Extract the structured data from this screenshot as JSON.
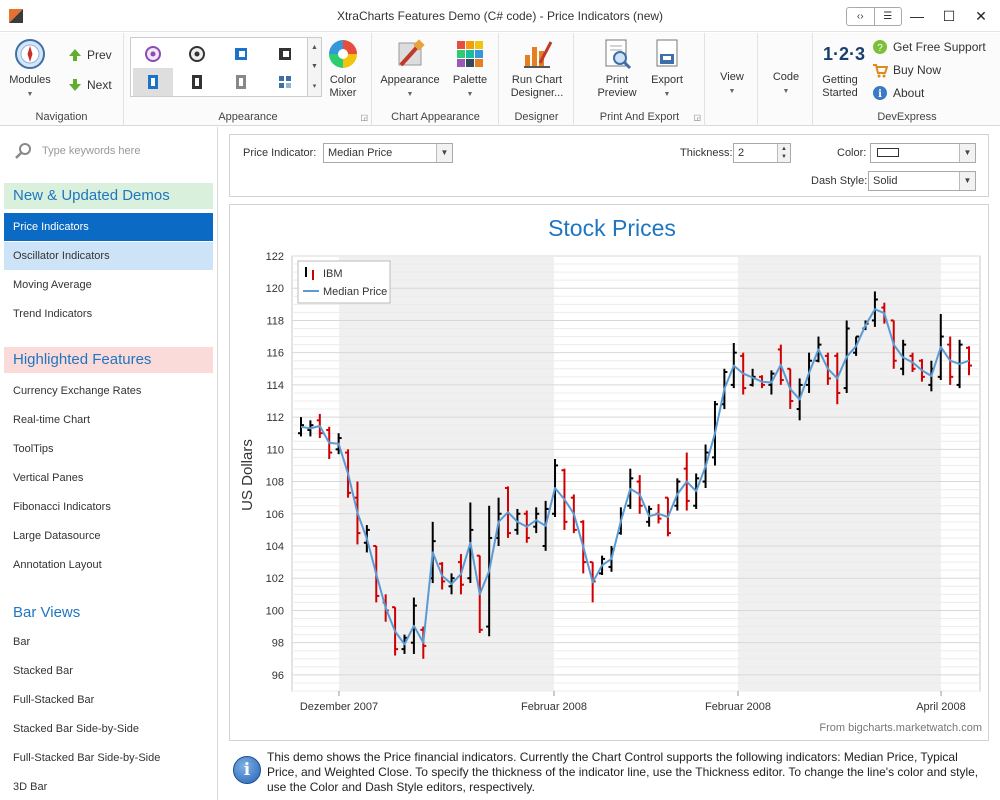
{
  "window": {
    "title": "XtraCharts Features Demo (C# code) - Price Indicators (new)",
    "controls": {
      "minimize": "—",
      "maximize": "☐",
      "close": "✕"
    }
  },
  "ribbon": {
    "navigation": {
      "label": "Navigation",
      "modules": "Modules",
      "prev": "Prev",
      "next": "Next"
    },
    "appearance": {
      "label": "Appearance",
      "color_mixer_1": "Color",
      "color_mixer_2": "Mixer"
    },
    "chart_appearance": {
      "label": "Chart Appearance",
      "appearance": "Appearance",
      "palette": "Palette"
    },
    "designer": {
      "label": "Designer",
      "run_1": "Run Chart",
      "run_2": "Designer..."
    },
    "print_export": {
      "label": "Print And Export",
      "print_1": "Print",
      "print_2": "Preview",
      "export": "Export"
    },
    "view": {
      "label": "View"
    },
    "code": {
      "label": "Code"
    },
    "devexpress": {
      "label": "DevExpress",
      "getting_1": "Getting",
      "getting_2": "Started",
      "getting_icon_text": "1·2·3",
      "support": "Get Free Support",
      "buy": "Buy Now",
      "about": "About"
    }
  },
  "sidebar": {
    "search_placeholder": "Type keywords here",
    "section1": "New & Updated Demos",
    "items1": [
      "Price Indicators",
      "Oscillator Indicators",
      "Moving Average",
      "Trend Indicators"
    ],
    "section2": "Highlighted Features",
    "items2": [
      "Currency Exchange Rates",
      "Real-time Chart",
      "ToolTips",
      "Vertical Panes",
      "Fibonacci Indicators",
      "Large Datasource",
      "Annotation Layout"
    ],
    "section3": "Bar Views",
    "items3": [
      "Bar",
      "Stacked Bar",
      "Full-Stacked Bar",
      "Stacked Bar Side-by-Side",
      "Full-Stacked Bar Side-by-Side",
      "3D Bar"
    ]
  },
  "options": {
    "indicator_label": "Price Indicator:",
    "indicator_value": "Median Price",
    "thickness_label": "Thickness:",
    "thickness_value": "2",
    "color_label": "Color:",
    "dash_label": "Dash Style:",
    "dash_value": "Solid"
  },
  "colors": {
    "accent": "#0b6ac4",
    "rising": "#000000",
    "falling": "#d00000",
    "indicator": "#5a9bd5",
    "title": "#1f76c0"
  },
  "chart_data": {
    "type": "stock",
    "title": "Stock Prices",
    "ylabel": "US Dollars",
    "ylim": [
      95,
      122
    ],
    "yticks": [
      96,
      98,
      100,
      102,
      104,
      106,
      108,
      110,
      112,
      114,
      116,
      118,
      120,
      122
    ],
    "xticks": [
      "Dezember 2007",
      "Februar 2008",
      "Februar 2008",
      "April 2008"
    ],
    "source": "From bigcharts.marketwatch.com",
    "legend": {
      "position": "top-left",
      "stock": "IBM",
      "indicator": "Median Price"
    },
    "series": [
      {
        "name": "IBM",
        "bars": [
          {
            "h": 112.0,
            "l": 110.8,
            "o": 111.0,
            "c": 111.5
          },
          {
            "h": 111.8,
            "l": 110.8,
            "o": 111.2,
            "c": 111.5
          },
          {
            "h": 112.2,
            "l": 110.7,
            "o": 111.8,
            "c": 111.0
          },
          {
            "h": 111.4,
            "l": 109.4,
            "o": 111.2,
            "c": 109.8
          },
          {
            "h": 111.0,
            "l": 109.7,
            "o": 110.0,
            "c": 110.7
          },
          {
            "h": 110.0,
            "l": 107.0,
            "o": 109.8,
            "c": 107.3
          },
          {
            "h": 108.0,
            "l": 104.1,
            "o": 107.0,
            "c": 104.8
          },
          {
            "h": 105.3,
            "l": 103.6,
            "o": 104.2,
            "c": 105.0
          },
          {
            "h": 104.0,
            "l": 100.5,
            "o": 104.0,
            "c": 100.9
          },
          {
            "h": 101.0,
            "l": 99.3,
            "o": 100.5,
            "c": 100.0
          },
          {
            "h": 100.2,
            "l": 97.2,
            "o": 100.2,
            "c": 97.6
          },
          {
            "h": 98.5,
            "l": 97.3,
            "o": 97.6,
            "c": 98.3
          },
          {
            "h": 100.8,
            "l": 97.3,
            "o": 98.0,
            "c": 100.3
          },
          {
            "h": 99.0,
            "l": 97.0,
            "o": 98.8,
            "c": 97.8
          },
          {
            "h": 105.5,
            "l": 101.7,
            "o": 102.0,
            "c": 104.3
          },
          {
            "h": 103.0,
            "l": 101.3,
            "o": 102.9,
            "c": 101.8
          },
          {
            "h": 102.3,
            "l": 101.0,
            "o": 101.5,
            "c": 102.0
          },
          {
            "h": 103.5,
            "l": 101.0,
            "o": 103.0,
            "c": 101.6
          },
          {
            "h": 106.7,
            "l": 101.7,
            "o": 102.0,
            "c": 105.0
          },
          {
            "h": 103.4,
            "l": 98.6,
            "o": 103.4,
            "c": 98.8
          },
          {
            "h": 106.5,
            "l": 98.4,
            "o": 99.0,
            "c": 104.5
          },
          {
            "h": 107.0,
            "l": 104.0,
            "o": 104.5,
            "c": 106.0
          },
          {
            "h": 107.7,
            "l": 104.5,
            "o": 107.6,
            "c": 104.8
          },
          {
            "h": 106.3,
            "l": 104.7,
            "o": 105.0,
            "c": 106.0
          },
          {
            "h": 106.2,
            "l": 104.2,
            "o": 106.0,
            "c": 104.5
          },
          {
            "h": 106.4,
            "l": 104.8,
            "o": 105.2,
            "c": 106.0
          },
          {
            "h": 106.8,
            "l": 103.7,
            "o": 104.0,
            "c": 106.3
          },
          {
            "h": 109.4,
            "l": 105.8,
            "o": 106.0,
            "c": 109.0
          },
          {
            "h": 108.8,
            "l": 105.0,
            "o": 108.7,
            "c": 105.5
          },
          {
            "h": 107.2,
            "l": 104.8,
            "o": 107.0,
            "c": 105.0
          },
          {
            "h": 105.6,
            "l": 102.3,
            "o": 105.5,
            "c": 103.0
          },
          {
            "h": 103.0,
            "l": 100.5,
            "o": 103.0,
            "c": 101.8
          },
          {
            "h": 103.4,
            "l": 102.2,
            "o": 102.3,
            "c": 103.2
          },
          {
            "h": 104.0,
            "l": 102.4,
            "o": 102.7,
            "c": 103.8
          },
          {
            "h": 106.4,
            "l": 104.7,
            "o": 104.8,
            "c": 106.0
          },
          {
            "h": 108.8,
            "l": 106.3,
            "o": 106.5,
            "c": 108.2
          },
          {
            "h": 108.4,
            "l": 106.0,
            "o": 108.0,
            "c": 106.5
          },
          {
            "h": 106.5,
            "l": 105.2,
            "o": 105.5,
            "c": 106.3
          },
          {
            "h": 106.6,
            "l": 105.4,
            "o": 106.0,
            "c": 105.7
          },
          {
            "h": 107.0,
            "l": 104.6,
            "o": 107.0,
            "c": 104.8
          },
          {
            "h": 108.2,
            "l": 106.2,
            "o": 106.5,
            "c": 108.0
          },
          {
            "h": 109.8,
            "l": 106.2,
            "o": 108.8,
            "c": 106.8
          },
          {
            "h": 108.5,
            "l": 106.3,
            "o": 106.5,
            "c": 108.2
          },
          {
            "h": 110.3,
            "l": 107.6,
            "o": 108.0,
            "c": 109.8
          },
          {
            "h": 113.0,
            "l": 109.0,
            "o": 109.5,
            "c": 112.8
          },
          {
            "h": 115.0,
            "l": 112.5,
            "o": 112.8,
            "c": 114.8
          },
          {
            "h": 116.6,
            "l": 113.8,
            "o": 114.0,
            "c": 116.0
          },
          {
            "h": 116.0,
            "l": 113.4,
            "o": 115.8,
            "c": 113.8
          },
          {
            "h": 115.0,
            "l": 113.9,
            "o": 114.0,
            "c": 114.5
          },
          {
            "h": 114.6,
            "l": 113.8,
            "o": 114.5,
            "c": 114.0
          },
          {
            "h": 114.9,
            "l": 113.4,
            "o": 114.0,
            "c": 114.7
          },
          {
            "h": 116.5,
            "l": 114.0,
            "o": 116.2,
            "c": 114.3
          },
          {
            "h": 115.0,
            "l": 112.5,
            "o": 115.0,
            "c": 113.0
          },
          {
            "h": 114.4,
            "l": 111.8,
            "o": 112.5,
            "c": 114.0
          },
          {
            "h": 116.0,
            "l": 113.5,
            "o": 114.0,
            "c": 115.5
          },
          {
            "h": 117.0,
            "l": 115.4,
            "o": 115.5,
            "c": 116.5
          },
          {
            "h": 116.0,
            "l": 114.0,
            "o": 115.8,
            "c": 114.4
          },
          {
            "h": 116.0,
            "l": 112.8,
            "o": 115.8,
            "c": 113.5
          },
          {
            "h": 118.0,
            "l": 113.5,
            "o": 113.8,
            "c": 117.5
          },
          {
            "h": 117.0,
            "l": 115.8,
            "o": 116.0,
            "c": 117.0
          },
          {
            "h": 118.0,
            "l": 117.4,
            "o": 117.5,
            "c": 117.8
          },
          {
            "h": 119.8,
            "l": 117.6,
            "o": 118.0,
            "c": 119.3
          },
          {
            "h": 119.1,
            "l": 117.8,
            "o": 118.8,
            "c": 118.0
          },
          {
            "h": 118.0,
            "l": 115.0,
            "o": 118.0,
            "c": 115.5
          },
          {
            "h": 116.8,
            "l": 114.6,
            "o": 115.0,
            "c": 116.5
          },
          {
            "h": 116.0,
            "l": 114.8,
            "o": 115.8,
            "c": 115.0
          },
          {
            "h": 115.6,
            "l": 114.2,
            "o": 115.5,
            "c": 114.5
          },
          {
            "h": 115.5,
            "l": 113.6,
            "o": 114.0,
            "c": 115.0
          },
          {
            "h": 118.4,
            "l": 114.3,
            "o": 114.5,
            "c": 117.0
          },
          {
            "h": 117.0,
            "l": 114.0,
            "o": 116.5,
            "c": 114.5
          },
          {
            "h": 116.8,
            "l": 113.8,
            "o": 114.0,
            "c": 116.5
          },
          {
            "h": 116.4,
            "l": 114.6,
            "o": 116.3,
            "c": 115.2
          }
        ]
      }
    ]
  }
}
